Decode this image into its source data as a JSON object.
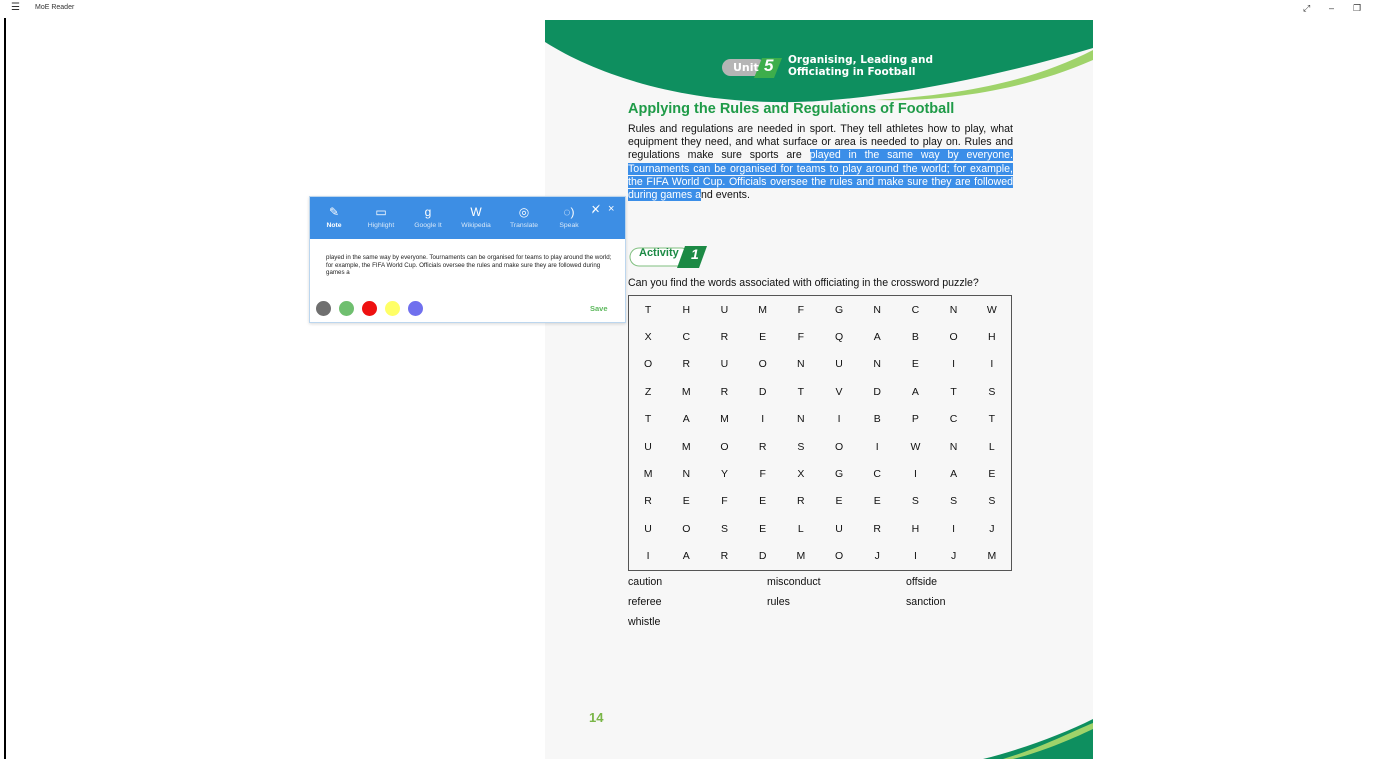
{
  "window": {
    "title": "MoE Reader",
    "menu_icon": "☰",
    "controls": [
      "⤢",
      "–",
      "❐"
    ]
  },
  "page": {
    "unit_word": "Unit",
    "unit_number": "5",
    "unit_title_line1": "Organising, Leading and",
    "unit_title_line2": "Officiating in Football",
    "section_heading": "Applying the Rules and Regulations of Football",
    "para_plain": "Rules and regulations are needed in sport. They tell athletes how to play, what equipment they need, and what surface or area is needed to play on. Rules and regulations make sure sports are ",
    "para_highlight": "played in the same way by everyone. Tournaments can be organised for teams to play around the world; for example, the FIFA World Cup. Officials oversee the rules and make sure they are followed during games a",
    "para_end": "nd events.",
    "activity_label": "Activity",
    "activity_number": "1",
    "question": "Can you find the words associated with officiating in the crossword puzzle?",
    "grid": [
      [
        "T",
        "H",
        "U",
        "M",
        "F",
        "G",
        "N",
        "C",
        "N",
        "W"
      ],
      [
        "X",
        "C",
        "R",
        "E",
        "F",
        "Q",
        "A",
        "B",
        "O",
        "H"
      ],
      [
        "O",
        "R",
        "U",
        "O",
        "N",
        "U",
        "N",
        "E",
        "I",
        "I"
      ],
      [
        "Z",
        "M",
        "R",
        "D",
        "T",
        "V",
        "D",
        "A",
        "T",
        "S"
      ],
      [
        "T",
        "A",
        "M",
        "I",
        "N",
        "I",
        "B",
        "P",
        "C",
        "T"
      ],
      [
        "U",
        "M",
        "O",
        "R",
        "S",
        "O",
        "I",
        "W",
        "N",
        "L"
      ],
      [
        "M",
        "N",
        "Y",
        "F",
        "X",
        "G",
        "C",
        "I",
        "A",
        "E"
      ],
      [
        "R",
        "E",
        "F",
        "E",
        "R",
        "E",
        "E",
        "S",
        "S",
        "S"
      ],
      [
        "U",
        "O",
        "S",
        "E",
        "L",
        "U",
        "R",
        "H",
        "I",
        "J"
      ],
      [
        "I",
        "A",
        "R",
        "D",
        "M",
        "O",
        "J",
        "I",
        "J",
        "M"
      ]
    ],
    "words": [
      "caution",
      "misconduct",
      "offside",
      "referee",
      "rules",
      "sanction",
      "whistle"
    ],
    "page_number": "14",
    "colors": {
      "green": "#0e8f5f",
      "heading": "#1f9b48",
      "highlight": "#3b8ee8"
    }
  },
  "popup": {
    "tools": [
      {
        "icon": "note-icon",
        "glyph": "✎",
        "label": "Note",
        "active": true
      },
      {
        "icon": "highlight-icon",
        "glyph": "▭",
        "label": "Highlight",
        "active": false
      },
      {
        "icon": "google-icon",
        "glyph": "g",
        "label": "Google It",
        "active": false
      },
      {
        "icon": "wikipedia-icon",
        "glyph": "W",
        "label": "Wikipedia",
        "active": false
      },
      {
        "icon": "translate-icon",
        "glyph": "◎",
        "label": "Translate",
        "active": false
      },
      {
        "icon": "speak-icon",
        "glyph": "◌)",
        "label": "Speak",
        "active": false
      }
    ],
    "pin_icon": "✕̸",
    "close_icon": "×",
    "note_text": "played in the same way by everyone. Tournaments can be organised for teams to play around the world; for example, the FIFA World Cup. Officials oversee the rules and make sure they are followed during games a",
    "swatches": [
      "#6f6f6f",
      "#6fbf6f",
      "#ee1111",
      "#ffff66",
      "#7070ee"
    ],
    "save_label": "Save"
  }
}
